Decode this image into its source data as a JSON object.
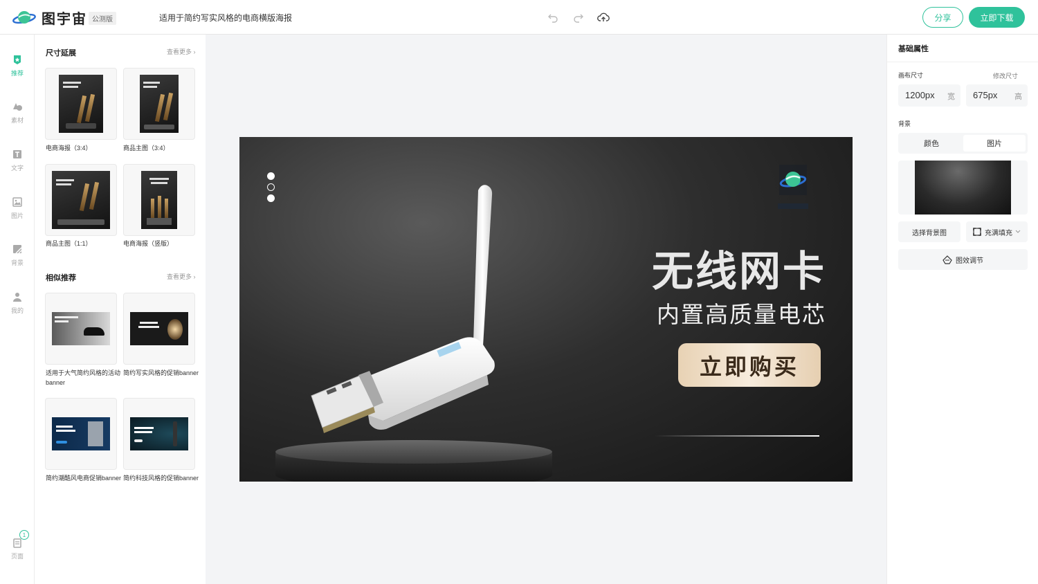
{
  "app": {
    "brand": "图宇宙",
    "beta_label": "公测版",
    "doc_title": "适用于简约写实风格的电商横版海报",
    "share_label": "分享",
    "download_label": "立即下载",
    "accent": "#2fc29b"
  },
  "nav": [
    {
      "label": "推荐",
      "icon": "recommend-icon",
      "active": true
    },
    {
      "label": "素材",
      "icon": "shapes-icon"
    },
    {
      "label": "文字",
      "icon": "text-icon"
    },
    {
      "label": "图片",
      "icon": "image-icon"
    },
    {
      "label": "背景",
      "icon": "background-icon"
    },
    {
      "label": "我的",
      "icon": "user-icon"
    },
    {
      "label": "页面",
      "icon": "pages-icon",
      "badge": "1"
    }
  ],
  "panel": {
    "size_section": {
      "title": "尺寸延展",
      "more": "查看更多",
      "items": [
        {
          "label": "电商海报（3:4）"
        },
        {
          "label": "商品主图（3:4）"
        },
        {
          "label": "商品主图（1:1）"
        },
        {
          "label": "电商海报（竖版）"
        }
      ]
    },
    "similar_section": {
      "title": "相似推荐",
      "more": "查看更多",
      "items": [
        {
          "label": "适用于大气简约风格的活动banner"
        },
        {
          "label": "简约写实风格的促销banner"
        },
        {
          "label": "简约潮酷风电商促销banner"
        },
        {
          "label": "简约科技风格的促销banner"
        }
      ]
    }
  },
  "poster": {
    "title": "无线网卡",
    "subtitle": "内置高质量电芯",
    "cta": "立即购买"
  },
  "props": {
    "title": "基础属性",
    "canvas_size_label": "画布尺寸",
    "edit_size_label": "修改尺寸",
    "width_value": "1200px",
    "width_unit": "宽",
    "height_value": "675px",
    "height_unit": "高",
    "background_label": "背景",
    "tab_color": "颜色",
    "tab_image": "图片",
    "choose_bg": "选择背景图",
    "fill_mode": "充满填充",
    "effect_adjust": "图效调节"
  }
}
